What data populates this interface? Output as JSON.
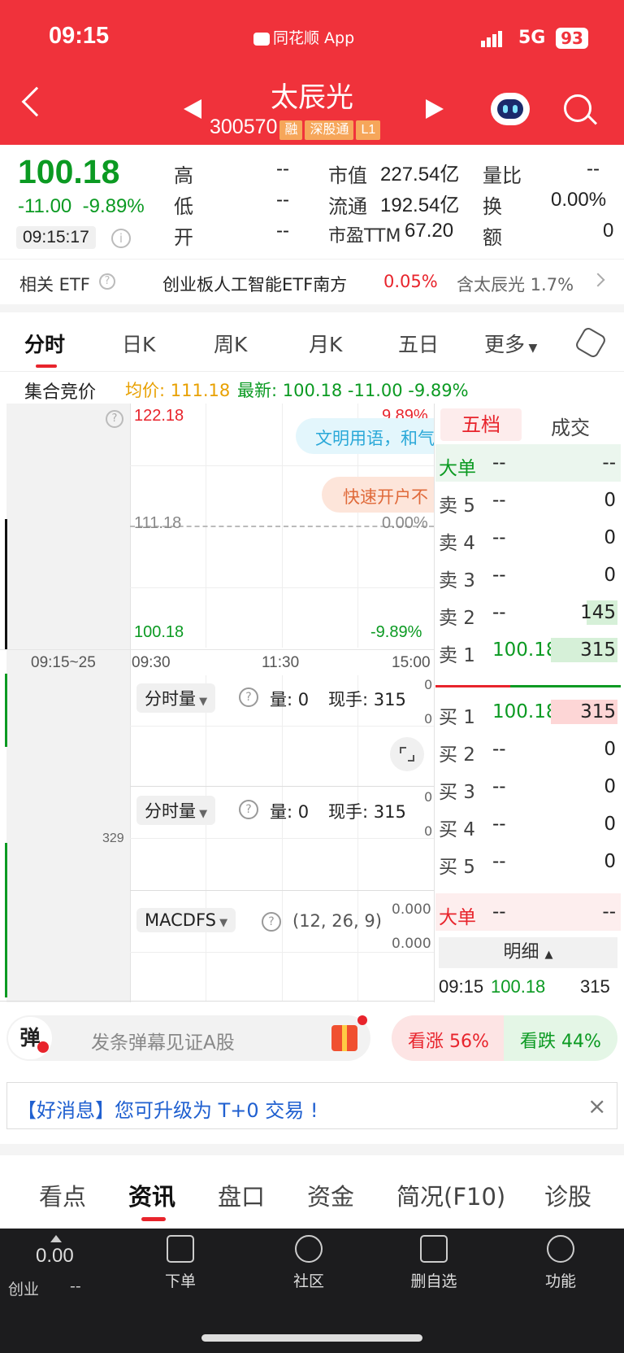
{
  "status_bar": {
    "time": "09:15",
    "app_label": "同花顺 App",
    "network": "5G",
    "battery": "93"
  },
  "header": {
    "stock_name": "太辰光",
    "stock_code": "300570",
    "tags": [
      "融",
      "深股通",
      "L1"
    ]
  },
  "quote": {
    "price": "100.18",
    "change": "-11.00",
    "change_pct": "-9.89%",
    "time": "09:15:17",
    "fields": [
      {
        "label": "高",
        "value": "--"
      },
      {
        "label": "低",
        "value": "--"
      },
      {
        "label": "开",
        "value": "--"
      },
      {
        "label": "市值",
        "value": "227.54亿"
      },
      {
        "label": "流通",
        "value": "192.54亿"
      },
      {
        "label": "市盈TTM",
        "value": "67.20"
      },
      {
        "label": "量比",
        "value": "--"
      },
      {
        "label": "换",
        "value": "0.00%"
      },
      {
        "label": "额",
        "value": "0"
      }
    ]
  },
  "etf": {
    "label": "相关 ETF",
    "name": "创业板人工智能ETF南方",
    "pct": "0.05%",
    "contain": "含太辰光 1.7%"
  },
  "chart_tabs": [
    "分时",
    "日K",
    "周K",
    "月K",
    "五日",
    "更多"
  ],
  "auction": {
    "label": "集合竞价",
    "avg_label": "均价: 111.18",
    "latest_label": "最新: 100.18 -11.00 -9.89%"
  },
  "chart": {
    "top_price": "122.18",
    "top_pct": "9.89%",
    "mid_price": "111.18",
    "mid_pct": "0.00%",
    "bottom_price": "100.18",
    "bottom_pct": "-9.89%",
    "times": [
      "09:15~25",
      "09:30",
      "11:30",
      "15:00"
    ],
    "bubble1": "文明用语，和气",
    "bubble2": "快速开户不",
    "vol_side": "329",
    "panel1": {
      "name": "分时量",
      "vol": "量: 0",
      "hand": "现手: 315",
      "right_top": "0",
      "right_bottom": "0"
    },
    "panel2": {
      "name": "分时量",
      "vol": "量: 0",
      "hand": "现手: 315",
      "right_top": "0",
      "right_bottom": "0"
    },
    "panel3": {
      "name": "MACDFS",
      "params": "(12, 26, 9)",
      "right_top": "0.000",
      "right_bottom": "0.000"
    }
  },
  "orderbook": {
    "tabs": [
      "五档",
      "成交"
    ],
    "big_sell": {
      "label": "大单",
      "p": "--",
      "v": "--"
    },
    "sells": [
      {
        "label": "卖 5",
        "p": "--",
        "v": "0"
      },
      {
        "label": "卖 4",
        "p": "--",
        "v": "0"
      },
      {
        "label": "卖 3",
        "p": "--",
        "v": "0"
      },
      {
        "label": "卖 2",
        "p": "--",
        "v": "145"
      },
      {
        "label": "卖 1",
        "p": "100.18",
        "v": "315"
      }
    ],
    "buys": [
      {
        "label": "买 1",
        "p": "100.18",
        "v": "315"
      },
      {
        "label": "买 2",
        "p": "--",
        "v": "0"
      },
      {
        "label": "买 3",
        "p": "--",
        "v": "0"
      },
      {
        "label": "买 4",
        "p": "--",
        "v": "0"
      },
      {
        "label": "买 5",
        "p": "--",
        "v": "0"
      }
    ],
    "big_buy": {
      "label": "大单",
      "p": "--",
      "v": "--"
    },
    "detail_label": "明细",
    "detail_row": {
      "t": "09:15",
      "p": "100.18",
      "v": "315"
    }
  },
  "danmaku": {
    "icon": "弹",
    "placeholder": "发条弹幕见证A股",
    "up": "看涨 56%",
    "down": "看跌 44%",
    "up_pct": 56
  },
  "notice": {
    "text": "【好消息】您可升级为 T+0 交易 !"
  },
  "bottom_tabs": [
    "看点",
    "资讯",
    "盘口",
    "资金",
    "简况(F10)",
    "诊股"
  ],
  "nav": {
    "index_value": "0.00",
    "index_name": "创业",
    "index_change": "--",
    "items": [
      "下单",
      "社区",
      "删自选",
      "功能"
    ]
  },
  "colors": {
    "header_red": "#f0323b",
    "up_red": "#e8242c",
    "down_green": "#0b9a22"
  }
}
